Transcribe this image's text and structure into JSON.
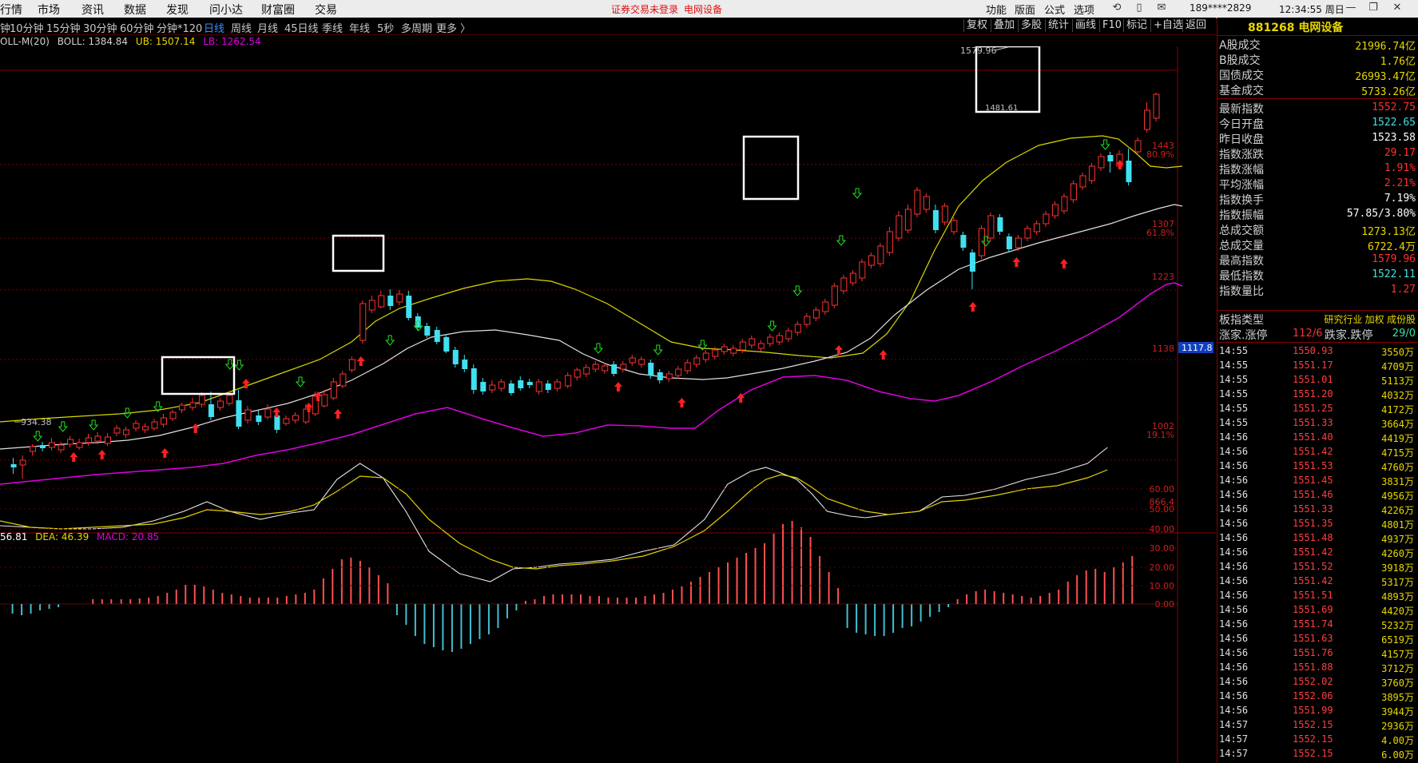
{
  "menubar": {
    "items": [
      "行情",
      "市场",
      "资讯",
      "数据",
      "发现",
      "问小达",
      "财富圈",
      "交易"
    ],
    "notice1": "证券交易未登录",
    "notice2": "电网设备",
    "right_items": [
      "功能",
      "版面",
      "公式",
      "选项"
    ],
    "account": "189****2829",
    "clock": "12:34:55 周日"
  },
  "toolbar": {
    "periods": [
      "钟",
      "10分钟",
      "15分钟",
      "30分钟",
      "60分钟",
      "分钟*120",
      "日线",
      "周线",
      "月线",
      "45日线",
      "季线",
      "年线",
      "5秒",
      "多周期",
      "更多 〉"
    ],
    "active_period": "日线",
    "right_buttons": [
      "复权",
      "叠加",
      "多股",
      "统计",
      "画线",
      "F10",
      "标记",
      "+自选",
      "返回"
    ]
  },
  "indicator": {
    "name": "OLL-M(20)",
    "boll_label": "BOLL: 1384.84",
    "ub_label": "UB: 1507.14",
    "lb_label": "LB: 1262.54"
  },
  "price_axis": {
    "labels": [
      "1443",
      "80.9%",
      "1307",
      "61.8%",
      "1223",
      "1138",
      "1002",
      "19.1%",
      "866.4"
    ],
    "current_price_tag": "1117.8"
  },
  "annotations": {
    "high_label": "1579.96",
    "low_label": "934.38",
    "last_close_label": "1481.61"
  },
  "macd": {
    "dif_label": "56.81",
    "dea_label": "DEA: 46.39",
    "macd_label": "MACD: 20.85",
    "axis_labels": [
      "60.00",
      "50.00",
      "40.00",
      "30.00",
      "20.00",
      "10.00",
      "0.00"
    ]
  },
  "right_panel": {
    "code_title": "881268 电网设备",
    "stats": [
      {
        "k": "A股成交",
        "v": "21996.74亿",
        "c": "yell"
      },
      {
        "k": "B股成交",
        "v": "1.76亿",
        "c": "yell"
      },
      {
        "k": "国债成交",
        "v": "26993.47亿",
        "c": "yell"
      },
      {
        "k": "基金成交",
        "v": "5733.26亿",
        "c": "yell"
      },
      {
        "k": "最新指数",
        "v": "1552.75",
        "c": "red"
      },
      {
        "k": "今日开盘",
        "v": "1522.65",
        "c": "cyan"
      },
      {
        "k": "昨日收盘",
        "v": "1523.58",
        "c": "white"
      },
      {
        "k": "指数涨跌",
        "v": "29.17",
        "c": "red"
      },
      {
        "k": "指数涨幅",
        "v": "1.91%",
        "c": "red"
      },
      {
        "k": "平均涨幅",
        "v": "2.21%",
        "c": "red"
      },
      {
        "k": "指数换手",
        "v": "7.19%",
        "c": "white"
      },
      {
        "k": "指数振幅",
        "v": "57.85/3.80%",
        "c": "white"
      },
      {
        "k": "总成交额",
        "v": "1273.13亿",
        "c": "yell"
      },
      {
        "k": "总成交量",
        "v": "6722.4万",
        "c": "yell"
      },
      {
        "k": "最高指数",
        "v": "1579.96",
        "c": "red"
      },
      {
        "k": "最低指数",
        "v": "1522.11",
        "c": "cyan"
      },
      {
        "k": "指数量比",
        "v": "1.27",
        "c": "red"
      }
    ],
    "type_label": "板指类型",
    "type_value": "研究行业 加权 成份股",
    "up_label": "涨家.涨停",
    "up_value": "112/6",
    "down_label": "跌家.跌停",
    "down_value": "29/0",
    "ticks": [
      {
        "t": "14:55",
        "p": "1550.93",
        "v": "3550万"
      },
      {
        "t": "14:55",
        "p": "1551.17",
        "v": "4709万"
      },
      {
        "t": "14:55",
        "p": "1551.01",
        "v": "5113万"
      },
      {
        "t": "14:55",
        "p": "1551.20",
        "v": "4032万"
      },
      {
        "t": "14:55",
        "p": "1551.25",
        "v": "4172万"
      },
      {
        "t": "14:55",
        "p": "1551.33",
        "v": "3664万"
      },
      {
        "t": "14:56",
        "p": "1551.40",
        "v": "4419万"
      },
      {
        "t": "14:56",
        "p": "1551.42",
        "v": "4715万"
      },
      {
        "t": "14:56",
        "p": "1551.53",
        "v": "4760万"
      },
      {
        "t": "14:56",
        "p": "1551.45",
        "v": "3831万"
      },
      {
        "t": "14:56",
        "p": "1551.46",
        "v": "4956万"
      },
      {
        "t": "14:56",
        "p": "1551.33",
        "v": "4226万"
      },
      {
        "t": "14:56",
        "p": "1551.35",
        "v": "4801万"
      },
      {
        "t": "14:56",
        "p": "1551.48",
        "v": "4937万"
      },
      {
        "t": "14:56",
        "p": "1551.42",
        "v": "4260万"
      },
      {
        "t": "14:56",
        "p": "1551.52",
        "v": "3918万"
      },
      {
        "t": "14:56",
        "p": "1551.42",
        "v": "5317万"
      },
      {
        "t": "14:56",
        "p": "1551.51",
        "v": "4893万"
      },
      {
        "t": "14:56",
        "p": "1551.69",
        "v": "4420万"
      },
      {
        "t": "14:56",
        "p": "1551.74",
        "v": "5232万"
      },
      {
        "t": "14:56",
        "p": "1551.63",
        "v": "6519万"
      },
      {
        "t": "14:56",
        "p": "1551.76",
        "v": "4157万"
      },
      {
        "t": "14:56",
        "p": "1551.88",
        "v": "3712万"
      },
      {
        "t": "14:56",
        "p": "1552.02",
        "v": "3760万"
      },
      {
        "t": "14:56",
        "p": "1552.06",
        "v": "3895万"
      },
      {
        "t": "14:56",
        "p": "1551.99",
        "v": "3944万"
      },
      {
        "t": "14:57",
        "p": "1552.15",
        "v": "2936万"
      },
      {
        "t": "14:57",
        "p": "1552.15",
        "v": "4.00万"
      },
      {
        "t": "14:57",
        "p": "1552.15",
        "v": "6.00万"
      }
    ]
  },
  "colors": {
    "up": "#ff3030",
    "down": "#40e0f0",
    "mid_line": "#e0e0e0",
    "upper_band": "#d8d800",
    "lower_band": "#e000e0",
    "grid_red": "#8a0000"
  }
}
